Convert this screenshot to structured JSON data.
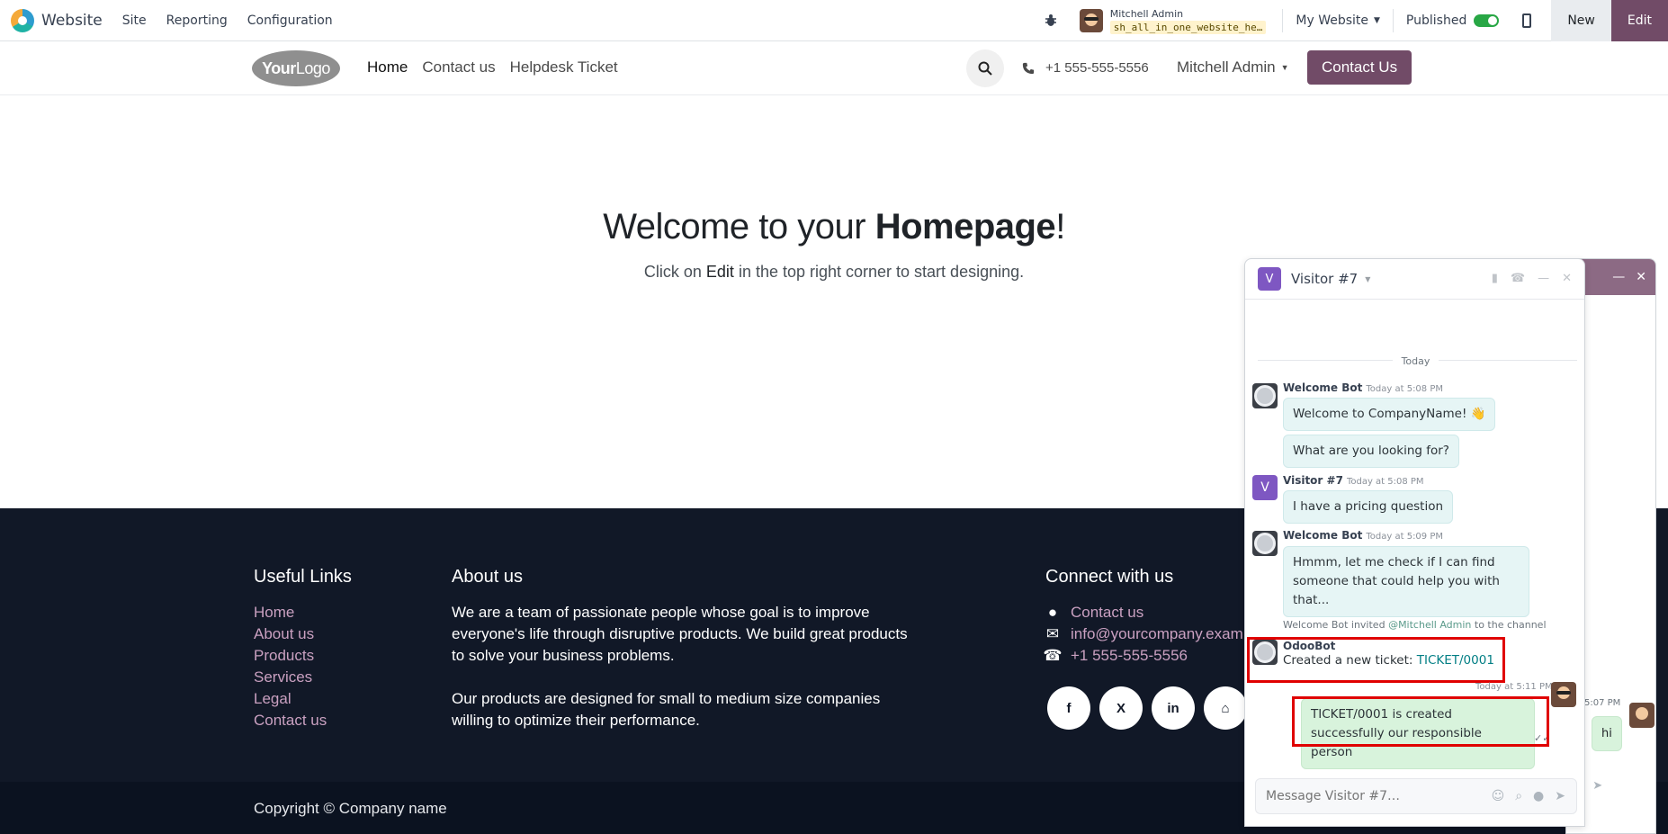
{
  "admin": {
    "app_name": "Website",
    "menu": [
      "Site",
      "Reporting",
      "Configuration"
    ],
    "user_name": "Mitchell Admin",
    "db_name": "sh_all_in_one_website_he…",
    "my_website": "My Website",
    "published": "Published",
    "new": "New",
    "edit": "Edit"
  },
  "site": {
    "logo_bold": "Your",
    "logo_rest": "Logo",
    "nav": [
      "Home",
      "Contact us",
      "Helpdesk Ticket"
    ],
    "phone": "+1 555-555-5556",
    "user": "Mitchell Admin",
    "cta": "Contact Us"
  },
  "hero": {
    "title_pre": "Welcome to your ",
    "title_bold": "Homepage",
    "title_post": "!",
    "sub_pre": "Click on ",
    "sub_bold": "Edit",
    "sub_post": " in the top right corner to start designing."
  },
  "footer": {
    "useful_title": "Useful Links",
    "links": [
      "Home",
      "About us",
      "Products",
      "Services",
      "Legal",
      "Contact us"
    ],
    "about_title": "About us",
    "about_p1": "We are a team of passionate people whose goal is to improve everyone's life through disruptive products. We build great products to solve your business problems.",
    "about_p2": "Our products are designed for small to medium size companies willing to optimize their performance.",
    "connect_title": "Connect with us",
    "connect_contact": "Contact us",
    "connect_email": "info@yourcompany.exam",
    "connect_phone": "+1 555-555-5556",
    "copyright": "Copyright © Company name"
  },
  "chat": {
    "title": "Visitor #7",
    "badge": "V",
    "today": "Today",
    "m1_author": "Welcome Bot",
    "m1_time": "Today at 5:08 PM",
    "m1_text": "Welcome to CompanyName! 👋",
    "m2_text": "What are you looking for?",
    "m3_author": "Visitor #7",
    "m3_time": "Today at 5:08 PM",
    "m3_text": "I have a pricing question",
    "m4_author": "Welcome Bot",
    "m4_time": "Today at 5:09 PM",
    "m4_text": "Hmmm, let me check if I can find someone that could help you with that...",
    "sys_pre": "Welcome Bot invited ",
    "sys_mention": "@Mitchell Admin",
    "sys_post": " to the channel",
    "m5_author": "OdooBot",
    "m5_text": "Created a new ticket: ",
    "m5_link": "TICKET/0001",
    "m6_time": "Today at 5:11 PM",
    "m6_text": "TICKET/0001 is created successfully our responsible person",
    "placeholder": "Message Visitor #7…"
  },
  "chat_back": {
    "time": "5:07 PM",
    "bubble": "hi"
  }
}
